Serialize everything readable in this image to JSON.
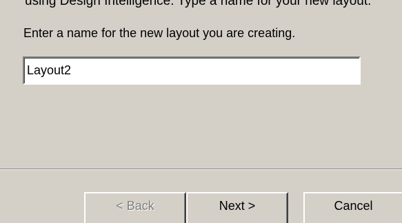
{
  "header": {
    "clipped_text": "using Design Intelligence. Type a name for your new layout."
  },
  "main": {
    "instruction": "Enter a name for the new layout you are creating.",
    "name_input": {
      "value": "Layout2"
    }
  },
  "footer": {
    "back_label": "< Back",
    "next_label": "Next >",
    "cancel_label": "Cancel"
  }
}
